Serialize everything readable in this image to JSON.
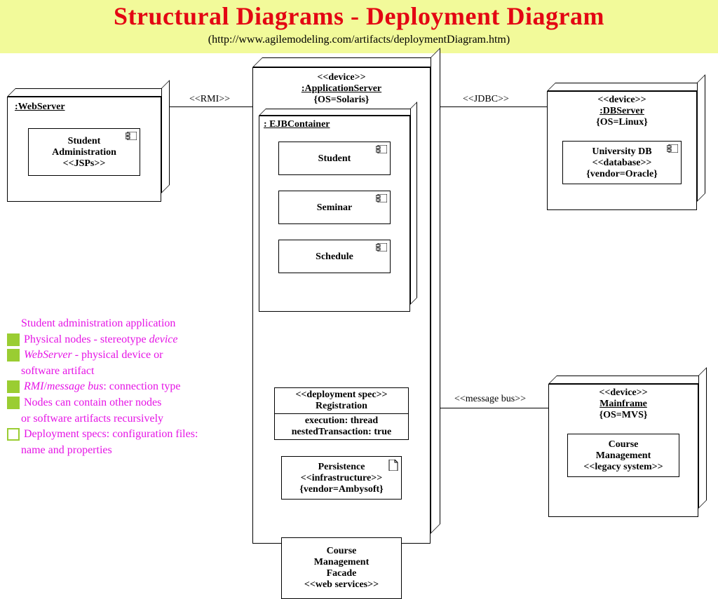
{
  "title": "Structural Diagrams - Deployment Diagram",
  "subtitle": "(http://www.agilemodeling.com/artifacts/deploymentDiagram.htm)",
  "nodes": {
    "webserver": {
      "name": ":WebServer"
    },
    "appserver": {
      "stereo": "<<device>>",
      "name": ":ApplicationServer",
      "tag": "{OS=Solaris}",
      "container": ": EJBContainer"
    },
    "dbserver": {
      "stereo": "<<device>>",
      "name": ":DBServer",
      "tag": "{OS=Linux}"
    },
    "mainframe": {
      "stereo": "<<device>>",
      "name": "Mainframe",
      "tag": "{OS=MVS}"
    }
  },
  "components": {
    "studentadmin": {
      "l1": "Student",
      "l2": "Administration",
      "stereo": "<<JSPs>>"
    },
    "student": {
      "name": "Student"
    },
    "seminar": {
      "name": "Seminar"
    },
    "schedule": {
      "name": "Schedule"
    },
    "regspec": {
      "stereo": "<<deployment spec>>",
      "name": "Registration",
      "p1": "execution: thread",
      "p2": "nestedTransaction: true"
    },
    "persist": {
      "name": "Persistence",
      "stereo": "<<infrastructure>>",
      "tag": "{vendor=Ambysoft}"
    },
    "cmfacade": {
      "l1": "Course",
      "l2": "Management",
      "l3": "Facade",
      "stereo": "<<web services>>"
    },
    "univdb": {
      "name": "University DB",
      "stereo": "<<database>>",
      "tag": "{vendor=Oracle}"
    },
    "cmlegacy": {
      "l1": "Course",
      "l2": "Management",
      "stereo": "<<legacy system>>"
    }
  },
  "connectors": {
    "rmi": "<<RMI>>",
    "jdbc": "<<JDBC>>",
    "msgbus": "<<message bus>>"
  },
  "notes": {
    "intro": "Student administration application",
    "b1a": "Physical nodes - stereotype ",
    "b1b": "device",
    "b2a": "WebServer",
    "b2b": " - physical device or",
    "b2c": "software artifact",
    "b3a": "RMI",
    "b3b": "/",
    "b3c": "message bus",
    "b3d": ": connection type",
    "b4a": "Nodes can contain other nodes",
    "b4b": "or software artifacts recursively",
    "b5a": "Deployment specs: configuration files:",
    "b5b": "name and properties"
  }
}
